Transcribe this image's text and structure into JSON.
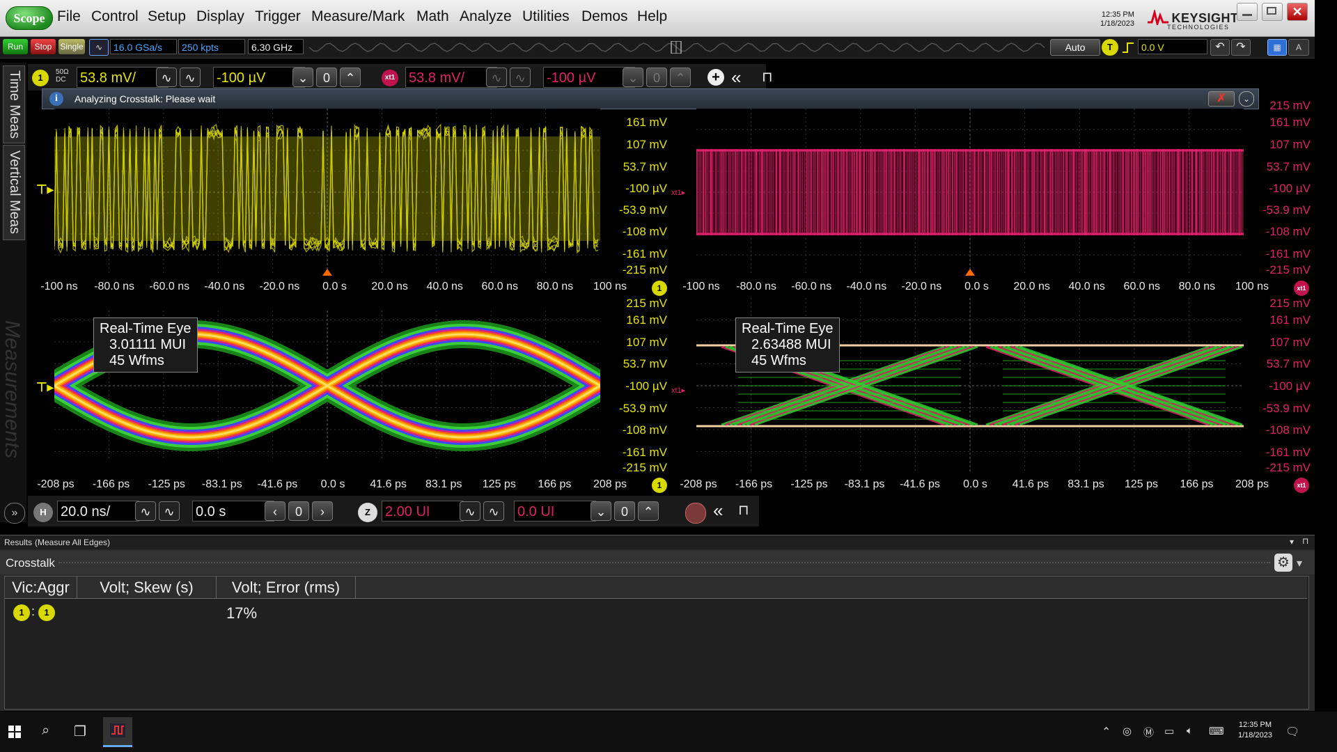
{
  "menubar": {
    "logo": "Scope",
    "items": [
      "File",
      "Control",
      "Setup",
      "Display",
      "Trigger",
      "Measure/Mark",
      "Math",
      "Analyze",
      "Utilities",
      "Demos",
      "Help"
    ],
    "clock_time": "12:35 PM",
    "clock_date": "1/18/2023",
    "brand_name": "KEYSIGHT",
    "brand_sub": "TECHNOLOGIES"
  },
  "toolbar": {
    "run": "Run",
    "stop": "Stop",
    "single": "Single",
    "sample_rate": "16.0 GSa/s",
    "memory_depth": "250 kpts",
    "bandwidth": "6.30 GHz",
    "trigger_mode": "Auto",
    "trigger_badge": "T",
    "trigger_level": "0.0 V"
  },
  "side_tabs": [
    "Time Meas",
    "Vertical Meas"
  ],
  "channel1": {
    "badge": "1",
    "impedance": "50Ω",
    "coupling": "DC",
    "scale": "53.8 mV/",
    "offset": "-100 µV"
  },
  "xtalk": {
    "badge": "xt1",
    "scale": "53.8 mV/",
    "offset": "-100 µV"
  },
  "info": {
    "text": "Analyzing Crosstalk: Please wait"
  },
  "top_plots": {
    "y_labels_left": [
      "161 mV",
      "107 mV",
      "53.7 mV",
      "-100 µV",
      "-53.9 mV",
      "-108 mV",
      "-161 mV",
      "-215 mV"
    ],
    "y_labels_right": [
      "215 mV",
      "161 mV",
      "107 mV",
      "53.7 mV",
      "-100 µV",
      "-53.9 mV",
      "-108 mV",
      "-161 mV",
      "-215 mV"
    ],
    "x_labels": [
      "-100 ns",
      "-80.0 ns",
      "-60.0 ns",
      "-40.0 ns",
      "-20.0 ns",
      "0.0 s",
      "20.0 ns",
      "40.0 ns",
      "60.0 ns",
      "80.0 ns",
      "100 ns"
    ]
  },
  "bottom_plots": {
    "y_labels_left": [
      "215 mV",
      "161 mV",
      "107 mV",
      "53.7 mV",
      "-100 µV",
      "-53.9 mV",
      "-108 mV",
      "-161 mV",
      "-215 mV"
    ],
    "y_labels_right": [
      "215 mV",
      "161 mV",
      "107 mV",
      "53.7 mV",
      "-100 µV",
      "-53.9 mV",
      "-108 mV",
      "-161 mV",
      "-215 mV"
    ],
    "x_labels": [
      "-208 ps",
      "-166 ps",
      "-125 ps",
      "-83.1 ps",
      "-41.6 ps",
      "0.0 s",
      "41.6 ps",
      "83.1 ps",
      "125 ps",
      "166 ps",
      "208 ps"
    ],
    "eye_left": {
      "title": "Real-Time Eye",
      "value": "3.01111 MUI",
      "wfms": "45 Wfms"
    },
    "eye_right": {
      "title": "Real-Time Eye",
      "value": "2.63488 MUI",
      "wfms": "45 Wfms"
    }
  },
  "horizontal": {
    "badge": "H",
    "scale": "20.0 ns/",
    "position": "0.0 s",
    "zoom_badge": "Z",
    "zoom_scale": "2.00 UI",
    "zoom_position": "0.0 UI"
  },
  "results": {
    "header": "Results",
    "subheader": "(Measure All Edges)",
    "panel_title": "Crosstalk",
    "columns": [
      "Vic:Aggr",
      "Volt; Skew (s)",
      "Volt; Error (rms)"
    ],
    "row": {
      "victim": "1",
      "aggressor": "1",
      "skew": "",
      "error": "17%"
    }
  },
  "taskbar": {
    "time": "12:35 PM",
    "date": "1/18/2023"
  },
  "colors": {
    "ch1": "#e6e600",
    "xtalk": "#e0206a"
  }
}
